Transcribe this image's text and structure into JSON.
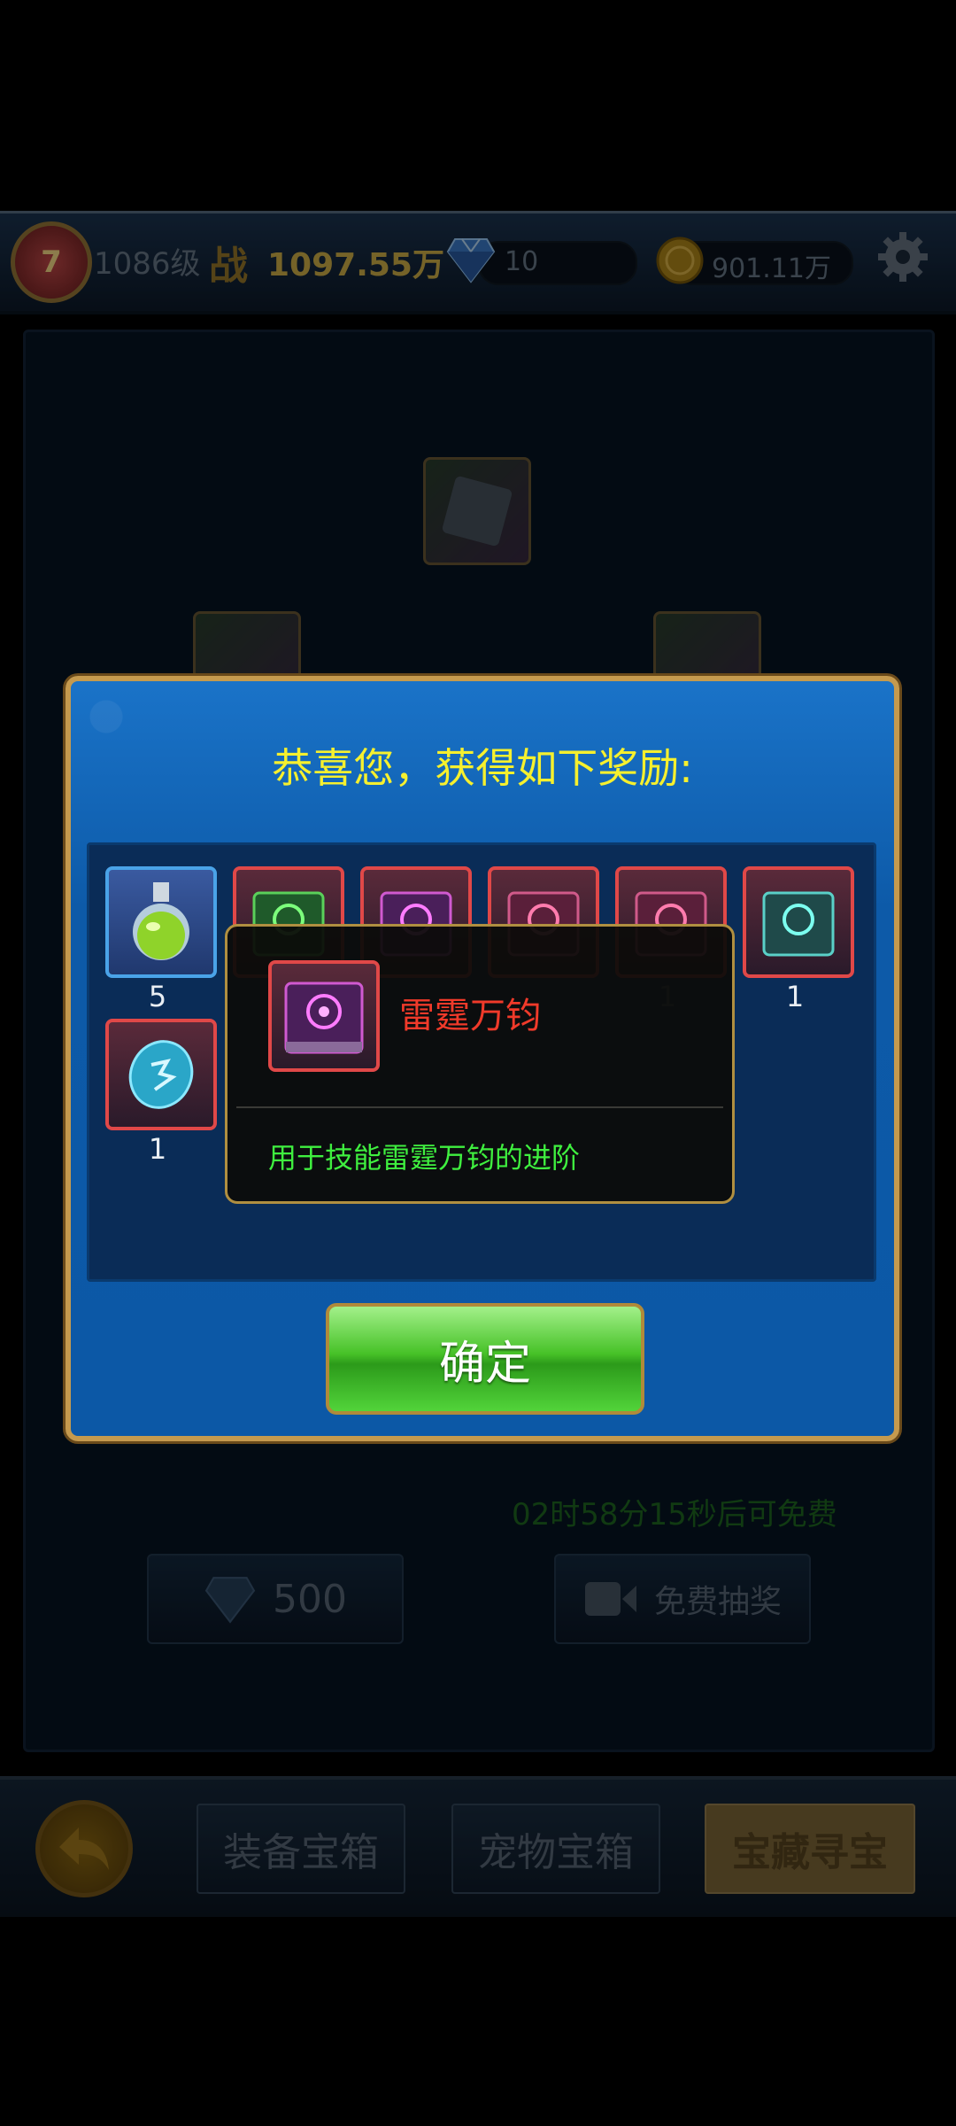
{
  "topbar": {
    "rank": "7",
    "level": "1086级",
    "power_label": "战",
    "power_value": "1097.55万",
    "diamonds": "10",
    "gold": "901.11万",
    "icons": [
      "diamond-icon",
      "gold-coin-icon",
      "settings-gear-icon"
    ]
  },
  "background": {
    "timer_text": "02时58分15秒后可免费",
    "diamond_cost": "500",
    "free_draw_label": "免费抽奖"
  },
  "bottom_nav": {
    "tabs": [
      "装备宝箱",
      "宠物宝箱",
      "宝藏寻宝"
    ],
    "active_tab": "宝藏寻宝"
  },
  "dialog": {
    "title": "恭喜您，获得如下奖励:",
    "items": [
      {
        "icon": "green-potion-icon",
        "count": "5"
      },
      {
        "icon": "green-skill-book-icon",
        "count": ""
      },
      {
        "icon": "purple-skill-book-icon",
        "count": ""
      },
      {
        "icon": "red-skill-book-icon",
        "count": "1"
      },
      {
        "icon": "red-skill-book-icon",
        "count": "1"
      },
      {
        "icon": "teal-skill-book-icon",
        "count": "1"
      },
      {
        "icon": "blue-rune-stone-icon",
        "count": "1"
      }
    ],
    "confirm_label": "确定"
  },
  "tooltip": {
    "item_name": "雷霆万钧",
    "description": "用于技能雷霆万钧的进阶"
  },
  "colors": {
    "dialog_blue": "#1a73c8",
    "title_yellow": "#f6f02e",
    "tooltip_name_red": "#f03a2a",
    "tooltip_desc_green": "#3fef3f",
    "confirm_green": "#47c228"
  }
}
